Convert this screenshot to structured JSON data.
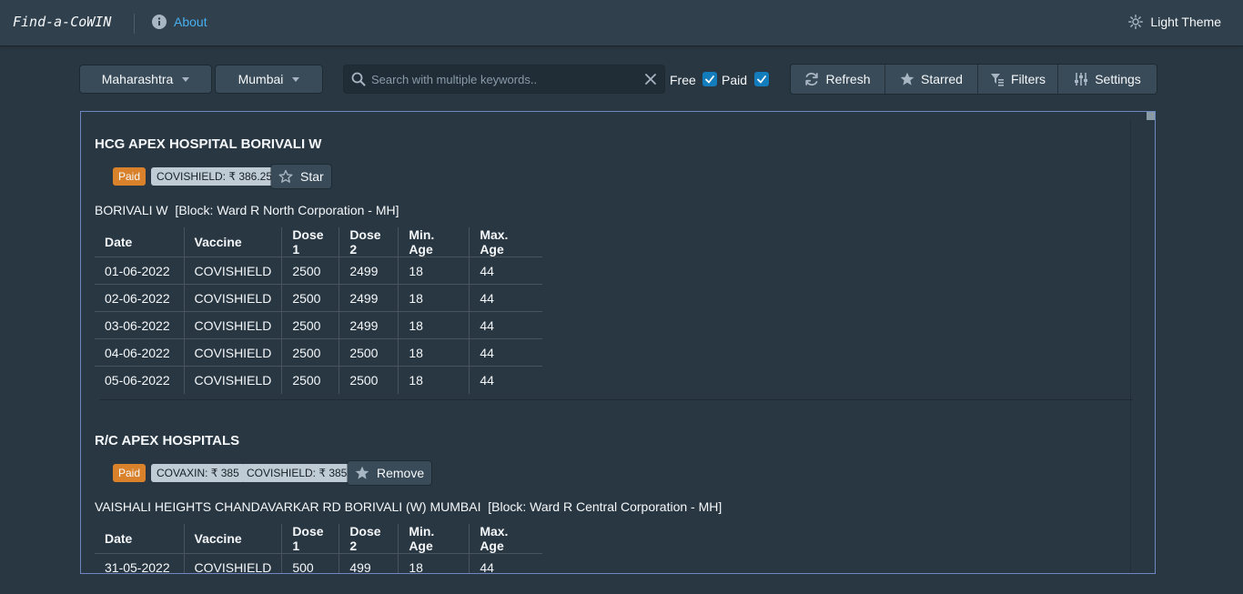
{
  "navbar": {
    "brand": "Find-a-CoWIN",
    "about_label": "About",
    "theme_label": "Light Theme"
  },
  "filters": {
    "state": "Maharashtra",
    "district": "Mumbai",
    "search_placeholder": "Search with multiple keywords..",
    "free_label": "Free",
    "free_checked": true,
    "paid_label": "Paid",
    "paid_checked": true
  },
  "toolbar": {
    "refresh_label": "Refresh",
    "starred_label": "Starred",
    "filters_label": "Filters",
    "settings_label": "Settings"
  },
  "columns": [
    "Date",
    "Vaccine",
    "Dose 1",
    "Dose 2",
    "Min. Age",
    "Max. Age"
  ],
  "centers": [
    {
      "name": "HCG APEX HOSPITAL BORIVALI W",
      "fee_type": "Paid",
      "prices": [
        "COVISHIELD: ₹ 386.25"
      ],
      "star_label": "Star",
      "starred": false,
      "address": "BORIVALI W  [Block: Ward R North Corporation - MH]",
      "sessions": [
        [
          "01-06-2022",
          "COVISHIELD",
          "2500",
          "2499",
          "18",
          "44"
        ],
        [
          "02-06-2022",
          "COVISHIELD",
          "2500",
          "2499",
          "18",
          "44"
        ],
        [
          "03-06-2022",
          "COVISHIELD",
          "2500",
          "2499",
          "18",
          "44"
        ],
        [
          "04-06-2022",
          "COVISHIELD",
          "2500",
          "2500",
          "18",
          "44"
        ],
        [
          "05-06-2022",
          "COVISHIELD",
          "2500",
          "2500",
          "18",
          "44"
        ]
      ]
    },
    {
      "name": "R/C APEX HOSPITALS",
      "fee_type": "Paid",
      "prices": [
        "COVAXIN: ₹ 385",
        "COVISHIELD: ₹ 385"
      ],
      "star_label": "Remove",
      "starred": true,
      "address": "VAISHALI HEIGHTS CHANDAVARKAR RD BORIVALI (W) MUMBAI  [Block: Ward R Central Corporation - MH]",
      "sessions": [
        [
          "31-05-2022",
          "COVISHIELD",
          "500",
          "499",
          "18",
          "44"
        ]
      ]
    }
  ],
  "colors": {
    "background": "#293742",
    "navbar": "#30404d",
    "link": "#48aff0",
    "checkbox": "#137cbd",
    "paid_tag": "#d9822b",
    "price_tag": "#bfccd6",
    "panel_border": "#6e87c0"
  }
}
